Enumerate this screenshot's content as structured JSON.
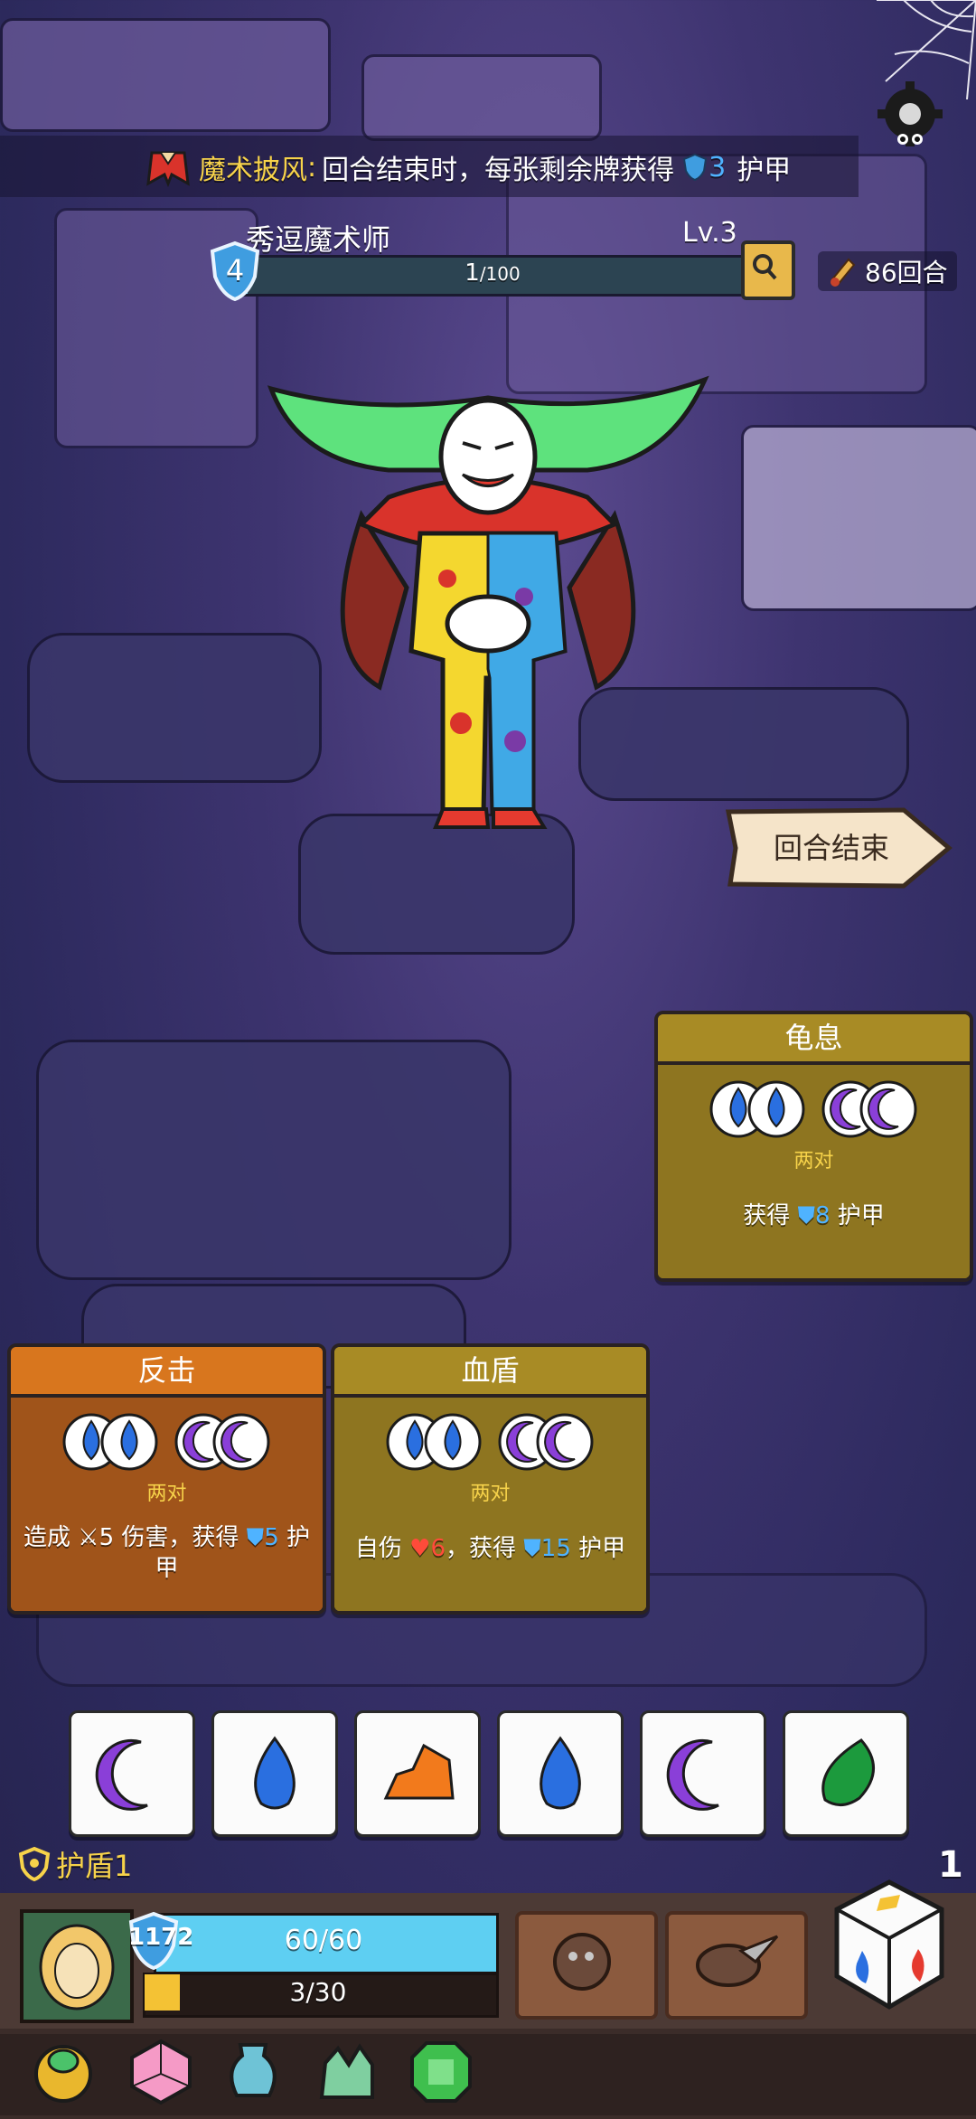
{
  "banner": {
    "relic_name": "魔术披风",
    "colon": ":",
    "text_before": "回合结束时，每张剩余牌获得",
    "armor_value": "3",
    "armor_word": "护甲"
  },
  "enemy": {
    "name": "秀逗魔术师",
    "shield_value": "4",
    "level": "Lv.3",
    "hp_current": "1",
    "hp_max": "/100",
    "hp_fraction": 0.01,
    "rounds": "86回合"
  },
  "end_turn_label": "回合结束",
  "cards": [
    {
      "title": "龟息",
      "requirement": "两对",
      "effect_prefix": "获得",
      "effect_value": "8",
      "effect_suffix": "护甲",
      "color": "#a88b25"
    },
    {
      "title": "反击",
      "requirement": "两对",
      "effect_prefix": "造成",
      "effect_damage": "5",
      "effect_mid": "伤害，获得",
      "effect_value": "5",
      "effect_suffix": "护甲",
      "color": "#c46a1c"
    },
    {
      "title": "血盾",
      "requirement": "两对",
      "effect_prefix": "自伤",
      "effect_self": "6",
      "effect_mid": "，获得",
      "effect_value": "15",
      "effect_suffix": "护甲",
      "color": "#a88b25"
    }
  ],
  "dice": [
    "moon-purple",
    "drop-blue",
    "rock-orange",
    "drop-blue",
    "moon-purple",
    "leaf-green"
  ],
  "player": {
    "shield_label": "护盾1",
    "armor": "1172",
    "hp_text": "60/60",
    "xp_text": "3/30",
    "xp_fraction": 0.1,
    "dice_count": "1"
  },
  "colors": {
    "gold": "#f7d34a",
    "armor_blue": "#4fb3ff",
    "hp_bar": "#5ecff2",
    "bg": "#3e3470"
  }
}
